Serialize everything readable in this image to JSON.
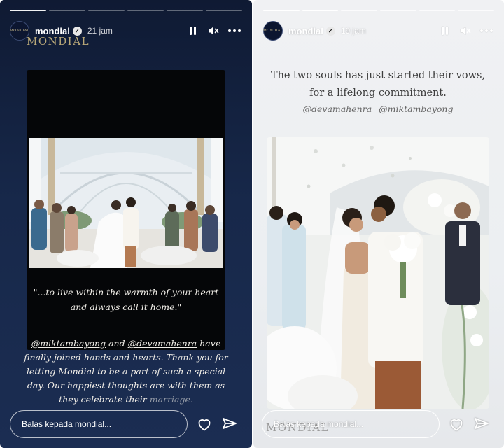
{
  "colors": {
    "left_bg": "#17284a",
    "right_bg": "#eceff2",
    "accent_gold": "#b9a878"
  },
  "left_story": {
    "progress": {
      "total_segments": 6,
      "completed_segments": 1
    },
    "header": {
      "avatar_text": "MONDIAL",
      "username": "mondial",
      "verified_icon": "verified-badge-icon",
      "time_ago": "21 jam"
    },
    "brand_watermark": "MONDIAL",
    "quote": "\"...to live within the warmth of your heart and always call it home.\"",
    "caption": {
      "mention_1": "@miktambayong",
      "and_text": "and",
      "mention_2": "@devamahenra",
      "text_1": "have finally joined hands and hearts. Thank you for letting Mondial to be a part of such a special day. Our happiest thoughts are with them as they celebrate their",
      "text_faded": "marriage."
    },
    "reply_placeholder": "Balas kepada mondial...",
    "icons": [
      "heart-icon",
      "send-icon"
    ]
  },
  "right_story": {
    "progress": {
      "total_segments": 6,
      "completed_segments": 2
    },
    "header": {
      "avatar_text": "MONDIAL",
      "username": "mondial",
      "verified_icon": "verified-badge-icon",
      "time_ago": "19 jam"
    },
    "headline": "The two souls has just started their vows, for a lifelong commitment.",
    "mentions": [
      "@devamahenra",
      "@miktambayong"
    ],
    "brand_watermark": "MONDIAL",
    "reply_placeholder": "Balas kepada mondial...",
    "icons": [
      "heart-icon",
      "send-icon"
    ]
  }
}
